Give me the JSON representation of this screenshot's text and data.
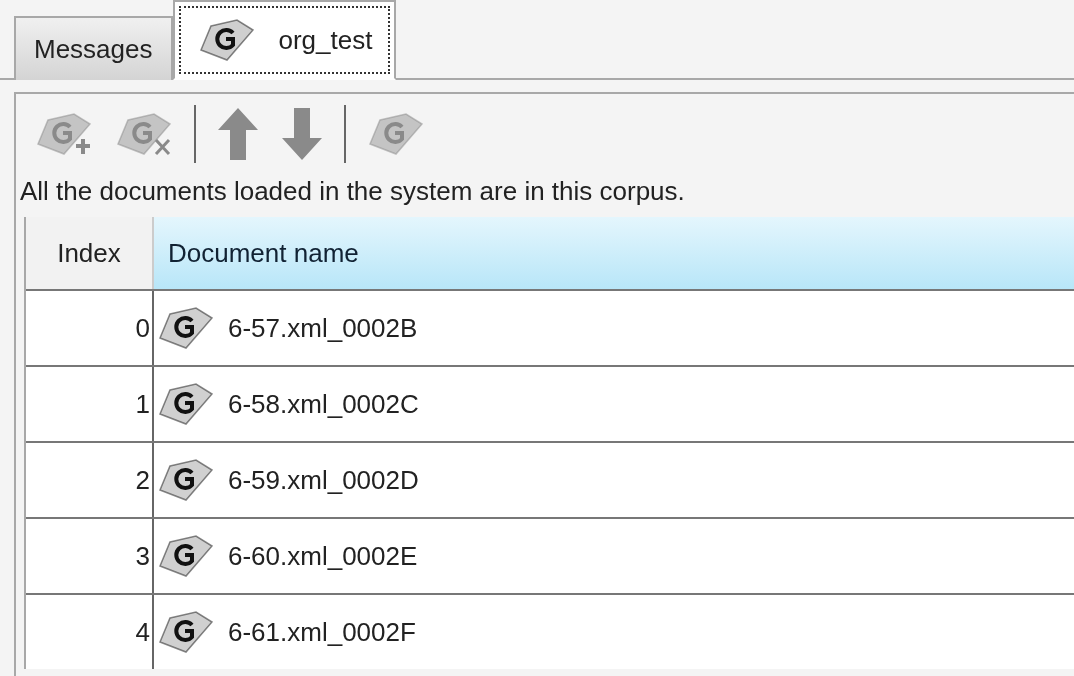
{
  "tabs": [
    {
      "label": "Messages",
      "selected": false,
      "icon": false
    },
    {
      "label": "org_test",
      "selected": true,
      "icon": true
    }
  ],
  "toolbar": [
    {
      "kind": "add-document",
      "disabled": true
    },
    {
      "kind": "remove-document",
      "disabled": true
    },
    {
      "kind": "separator"
    },
    {
      "kind": "move-up",
      "disabled": true
    },
    {
      "kind": "move-down",
      "disabled": true
    },
    {
      "kind": "separator"
    },
    {
      "kind": "document",
      "disabled": true
    }
  ],
  "description": "All the documents loaded in the system are in this corpus.",
  "table": {
    "columns": [
      "Index",
      "Document name"
    ],
    "rows": [
      {
        "index": "0",
        "name": "6-57.xml_0002B"
      },
      {
        "index": "1",
        "name": "6-58.xml_0002C"
      },
      {
        "index": "2",
        "name": "6-59.xml_0002D"
      },
      {
        "index": "3",
        "name": "6-60.xml_0002E"
      },
      {
        "index": "4",
        "name": "6-61.xml_0002F"
      }
    ]
  }
}
